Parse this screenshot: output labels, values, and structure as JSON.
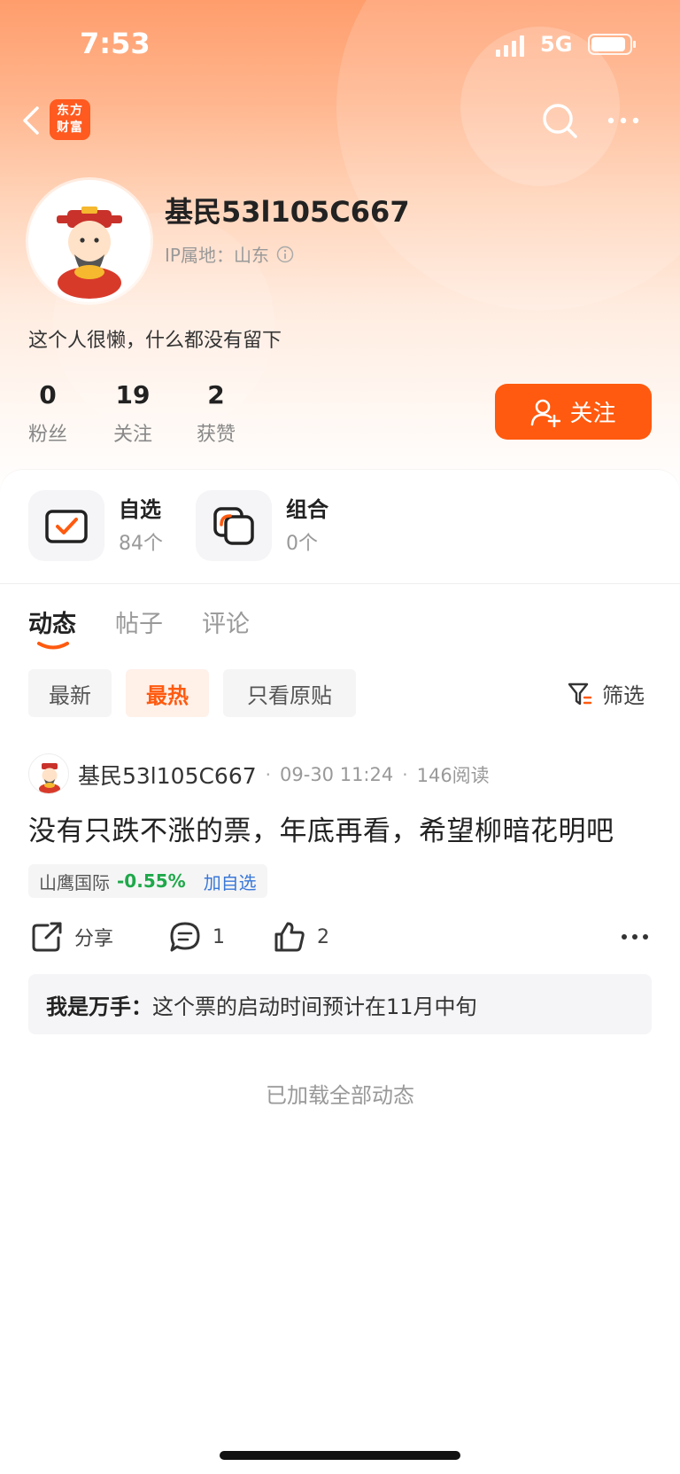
{
  "status_bar": {
    "time": "7:53",
    "network": "5G",
    "battery_level": 0.9
  },
  "nav": {
    "app_logo_line1": "东方",
    "app_logo_line2": "财富"
  },
  "profile": {
    "username": "基民53l105C667",
    "ip_location": "IP属地：山东",
    "bio": "这个人很懒，什么都没有留下",
    "stats": [
      {
        "value": "0",
        "label": "粉丝"
      },
      {
        "value": "19",
        "label": "关注"
      },
      {
        "value": "2",
        "label": "获赞"
      }
    ],
    "follow_label": "关注"
  },
  "shortcuts": [
    {
      "title": "自选",
      "subtitle": "84个"
    },
    {
      "title": "组合",
      "subtitle": "0个"
    }
  ],
  "tabs": [
    {
      "label": "动态",
      "active": true
    },
    {
      "label": "帖子",
      "active": false
    },
    {
      "label": "评论",
      "active": false
    }
  ],
  "filters": {
    "chips": [
      {
        "label": "最新",
        "active": false
      },
      {
        "label": "最热",
        "active": true
      },
      {
        "label": "只看原贴",
        "active": false
      }
    ],
    "filter_label": "筛选"
  },
  "post": {
    "author": "基民53l105C667",
    "time": "09-30 11:24",
    "reads": "146阅读",
    "content": "没有只跌不涨的票，年底再看，希望柳暗花明吧",
    "stock": {
      "name": "山鹰国际",
      "change": "-0.55%",
      "add_label": "加自选"
    },
    "actions": {
      "share": "分享",
      "comments": "1",
      "likes": "2"
    },
    "top_comment": {
      "author": "我是万手：",
      "text": "这个票的启动时间预计在11月中旬"
    }
  },
  "footer_text": "已加载全部动态",
  "colors": {
    "accent": "#ff5a0f",
    "stock_down": "#1fa84a",
    "link": "#3a78d8"
  }
}
